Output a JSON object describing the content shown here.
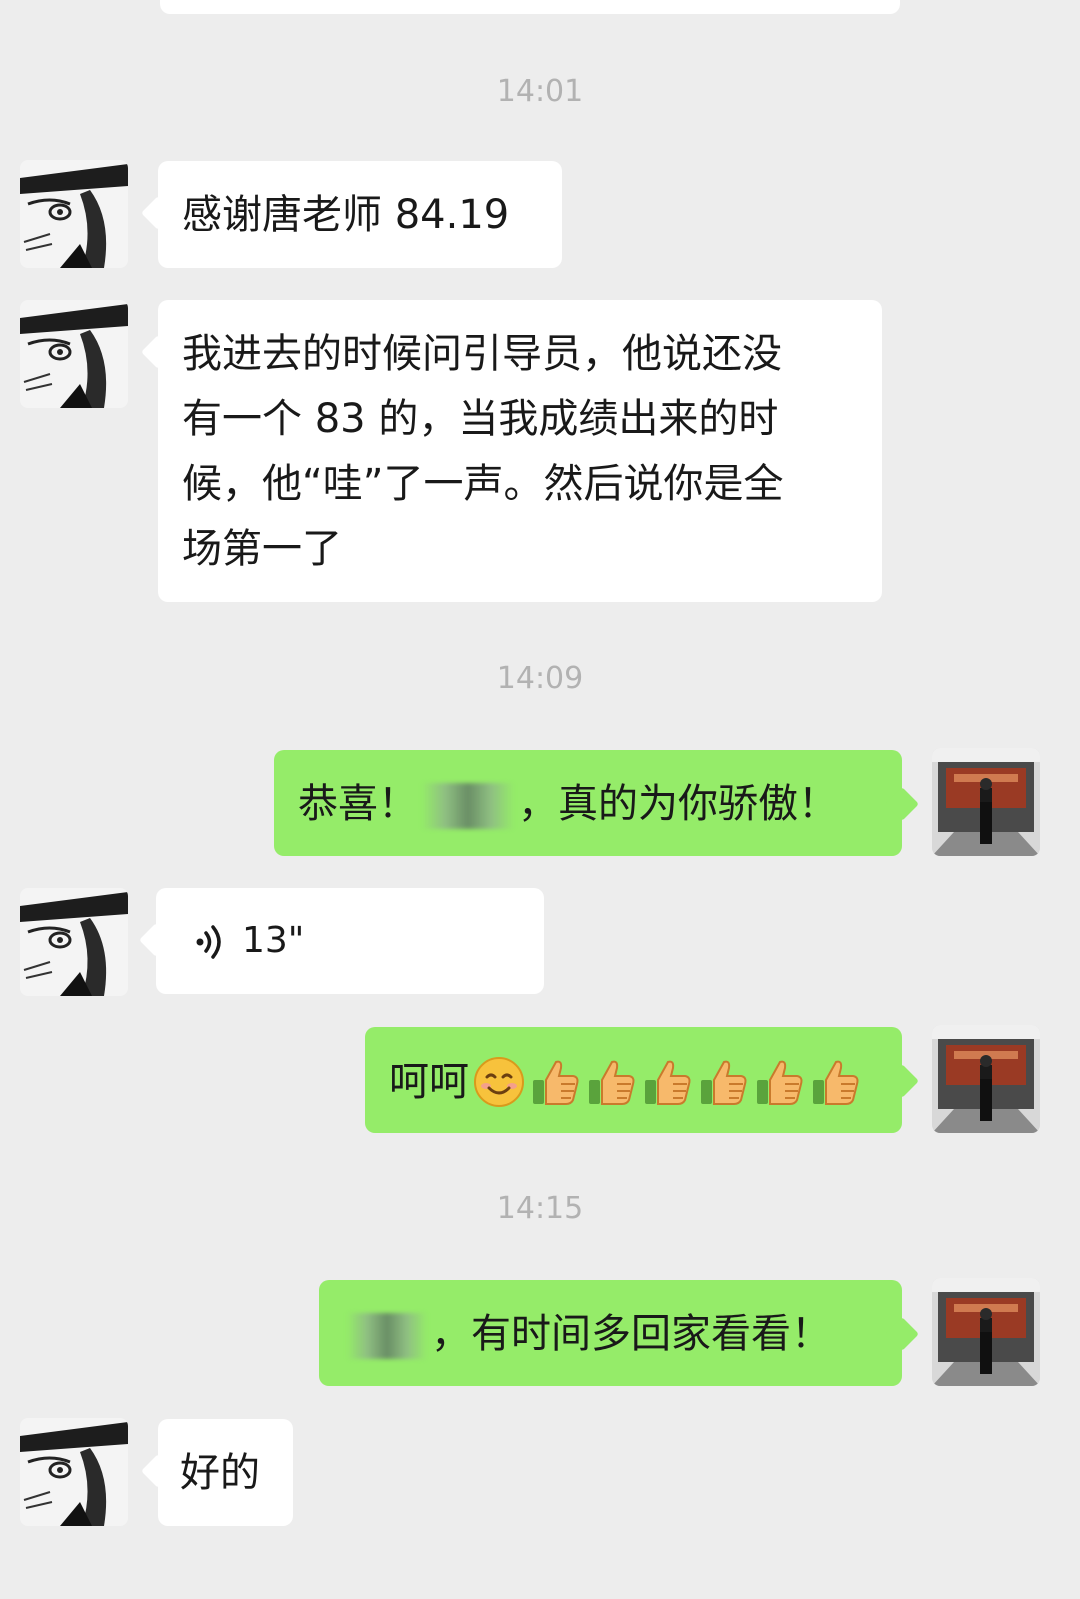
{
  "chat": {
    "timestamps": [
      "14:01",
      "14:09",
      "14:15"
    ],
    "messages": [
      {
        "side": "left",
        "text": "感谢唐老师 84.19"
      },
      {
        "side": "left",
        "lines": [
          "我进去的时候问引导员，他说还没",
          "有一个 83 的，当我成绩出来的时",
          "候，他“哇”了一声。然后说你是全",
          "场第一了"
        ]
      },
      {
        "side": "right",
        "prefix": "恭喜！",
        "suffix": "，真的为你骄傲！"
      },
      {
        "side": "left",
        "voice_duration": "13\""
      },
      {
        "side": "right",
        "text": "呵呵",
        "emojis": [
          "smile-emoji",
          "thumbs-up-emoji",
          "thumbs-up-emoji",
          "thumbs-up-emoji",
          "thumbs-up-emoji",
          "thumbs-up-emoji",
          "thumbs-up-emoji"
        ]
      },
      {
        "side": "right",
        "suffix": "，有时间多回家看看！"
      },
      {
        "side": "left",
        "text": "好的"
      }
    ]
  },
  "colors": {
    "background": "#ededed",
    "incoming_bubble": "#ffffff",
    "outgoing_bubble": "#95ec69",
    "timestamp": "#b2b2b2"
  }
}
